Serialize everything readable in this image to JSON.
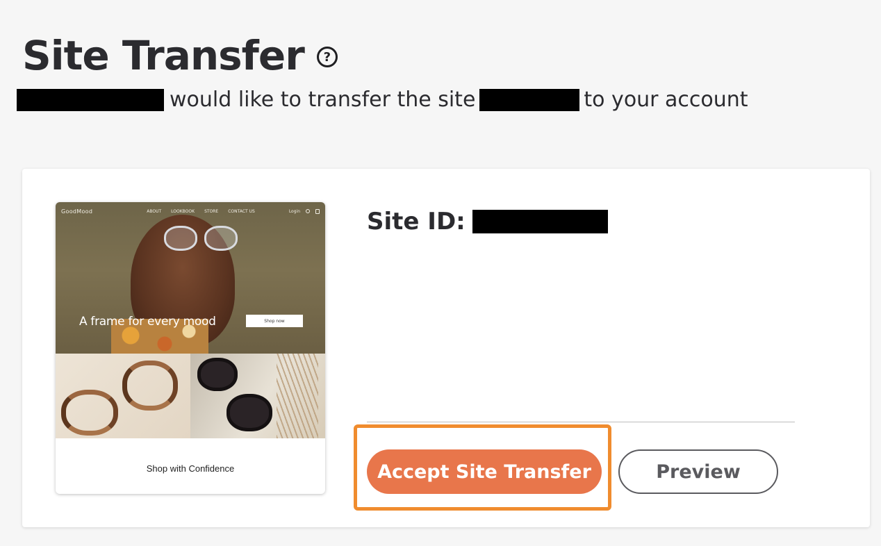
{
  "header": {
    "title": "Site Transfer",
    "help_icon": "?",
    "subtitle_part1": "would like to transfer the site",
    "subtitle_part2": "to your account"
  },
  "site": {
    "id_label": "Site ID:"
  },
  "preview_thumbnail": {
    "logo": "GoodMood",
    "nav_links": [
      "ABOUT",
      "LOOKBOOK",
      "STORE",
      "CONTACT US"
    ],
    "login": "Login",
    "tagline": "A frame for every mood",
    "shop_button": "Shop now",
    "footer_heading": "Shop with Confidence"
  },
  "actions": {
    "accept_label": "Accept Site Transfer",
    "preview_label": "Preview"
  },
  "colors": {
    "accent": "#e8764b",
    "highlight": "#f08c2e",
    "background": "#f6f6f6"
  }
}
